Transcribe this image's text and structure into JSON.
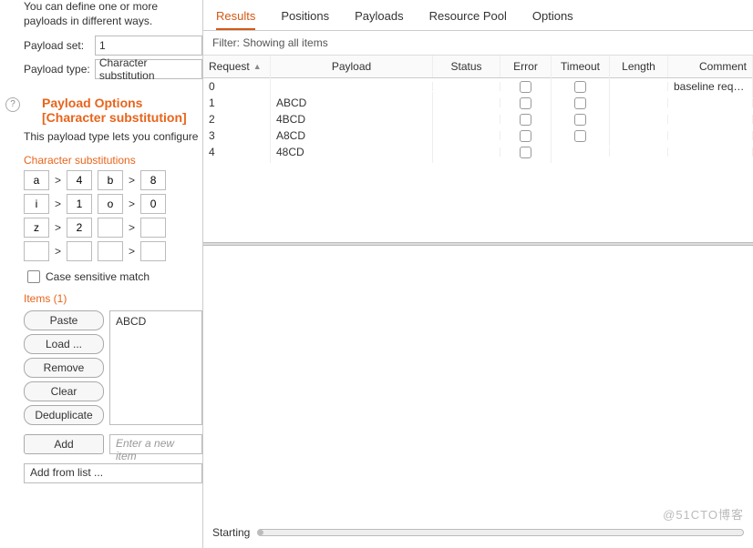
{
  "left": {
    "desc": "You can define one or more payloads in different ways.",
    "payload_set_label": "Payload set:",
    "payload_set_value": "1",
    "payload_type_label": "Payload type:",
    "payload_type_value": "Character substitution",
    "options_title": "Payload Options [Character substitution]",
    "options_desc": "This payload type lets you configure ",
    "subs_title": "Character substitutions",
    "subs": [
      [
        [
          "a",
          "4"
        ],
        [
          "b",
          "8"
        ]
      ],
      [
        [
          "i",
          "1"
        ],
        [
          "o",
          "0"
        ]
      ],
      [
        [
          "z",
          "2"
        ],
        [
          "",
          ""
        ]
      ],
      [
        [
          "",
          ""
        ],
        [
          "",
          ""
        ]
      ]
    ],
    "case_label": "Case sensitive match",
    "items_title": "Items (1)",
    "buttons": [
      "Paste",
      "Load ...",
      "Remove",
      "Clear",
      "Deduplicate"
    ],
    "list_item": "ABCD",
    "add_btn": "Add",
    "add_ph": "Enter a new item",
    "addfromlist": "Add from list ..."
  },
  "right": {
    "tabs": [
      "Results",
      "Positions",
      "Payloads",
      "Resource Pool",
      "Options"
    ],
    "active_tab": 0,
    "filter": "Filter: Showing all items",
    "columns": [
      "Request",
      "Payload",
      "Status",
      "Error",
      "Timeout",
      "Length",
      "Comment"
    ],
    "rows": [
      {
        "req": "0",
        "pay": "",
        "comment": "baseline request",
        "err": true,
        "to": true
      },
      {
        "req": "1",
        "pay": "ABCD",
        "comment": "",
        "err": true,
        "to": true
      },
      {
        "req": "2",
        "pay": "4BCD",
        "comment": "",
        "err": true,
        "to": true
      },
      {
        "req": "3",
        "pay": "A8CD",
        "comment": "",
        "err": true,
        "to": true
      },
      {
        "req": "4",
        "pay": "48CD",
        "comment": "",
        "err": true,
        "to": false
      }
    ],
    "status_label": "Starting",
    "watermark": "@51CTO博客"
  }
}
